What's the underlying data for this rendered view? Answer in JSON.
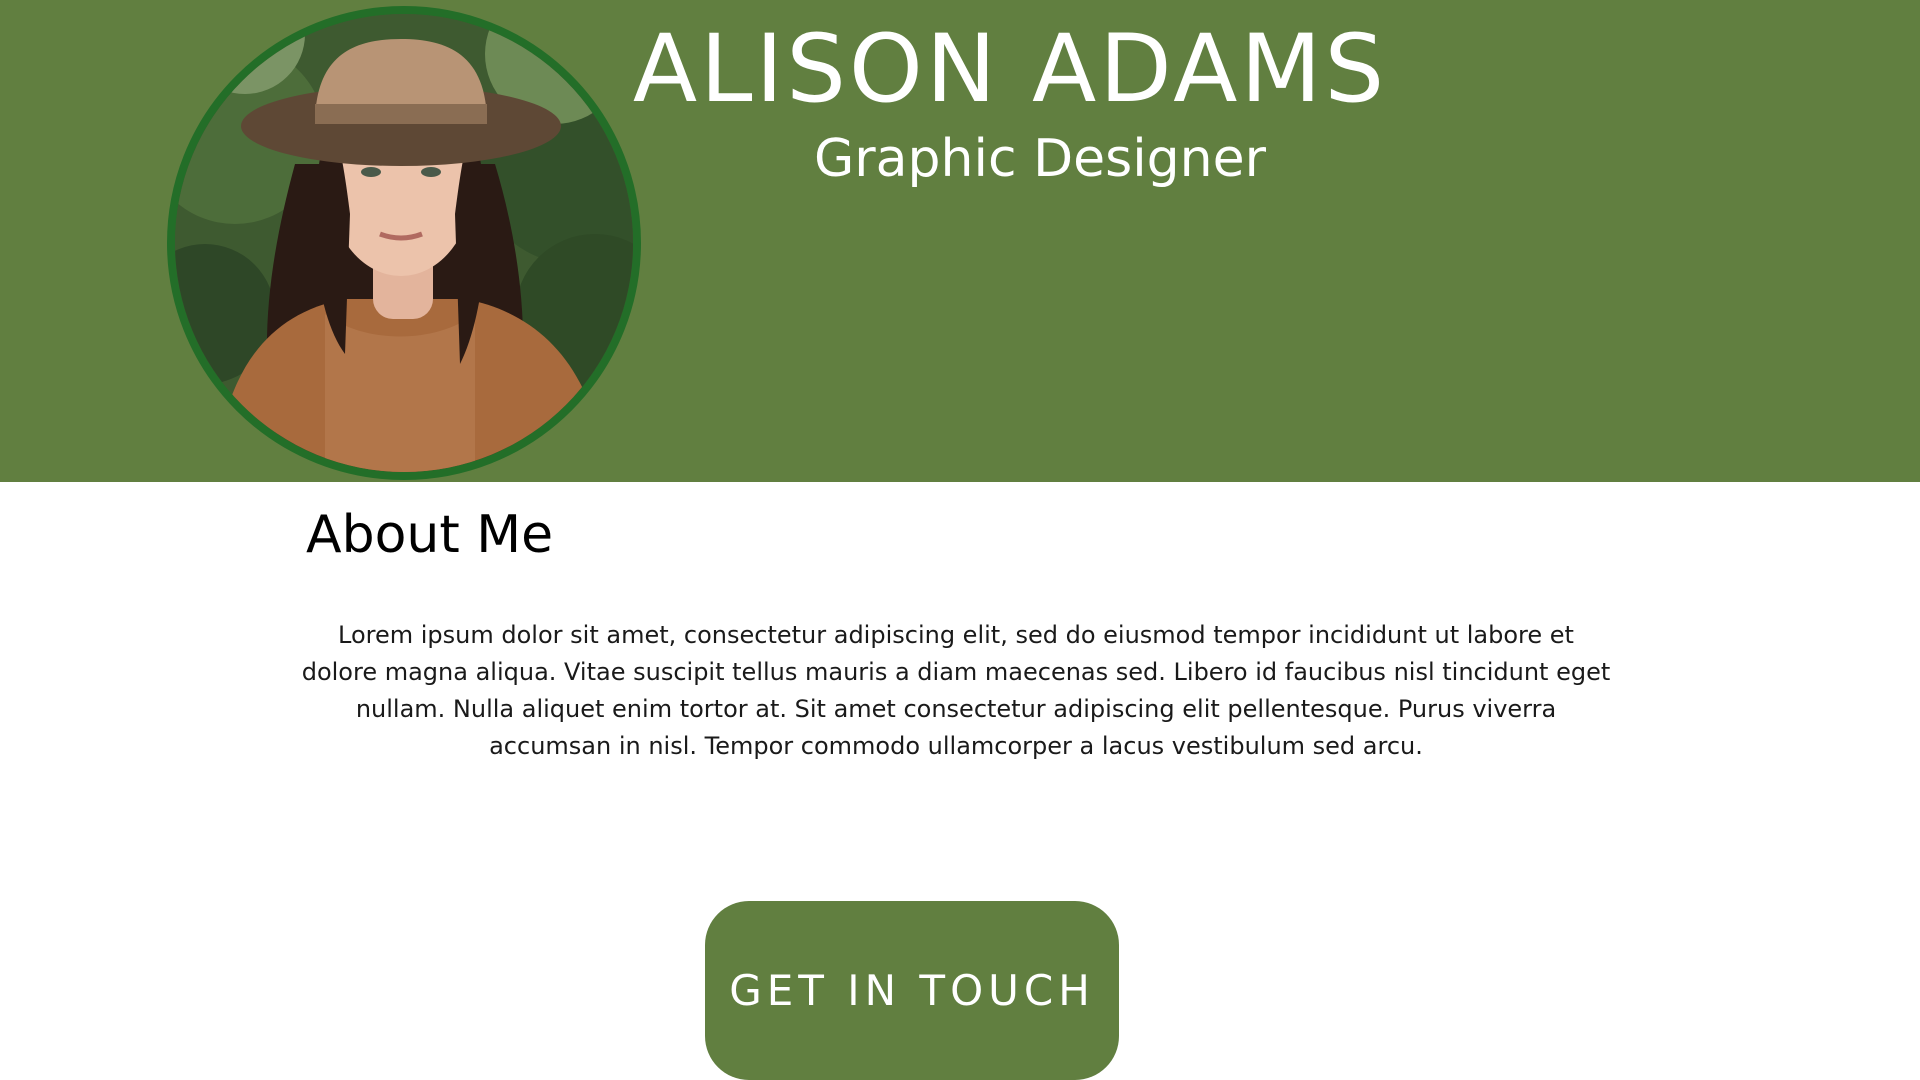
{
  "header": {
    "name": "ALISON ADAMS",
    "role": "Graphic Designer",
    "background_color": "#617f40"
  },
  "profile_photo": {
    "border_color": "#236e28"
  },
  "about": {
    "heading": "About Me",
    "body": "Lorem ipsum dolor sit amet, consectetur adipiscing elit, sed do eiusmod tempor incididunt ut labore et dolore magna aliqua. Vitae suscipit tellus mauris a diam maecenas sed. Libero id faucibus nisl tincidunt eget nullam. Nulla aliquet enim tortor at. Sit amet consectetur adipiscing elit pellentesque. Purus viverra accumsan in nisl. Tempor commodo ullamcorper a lacus vestibulum sed arcu."
  },
  "cta": {
    "label": "GET IN TOUCH",
    "background_color": "#617f40"
  }
}
